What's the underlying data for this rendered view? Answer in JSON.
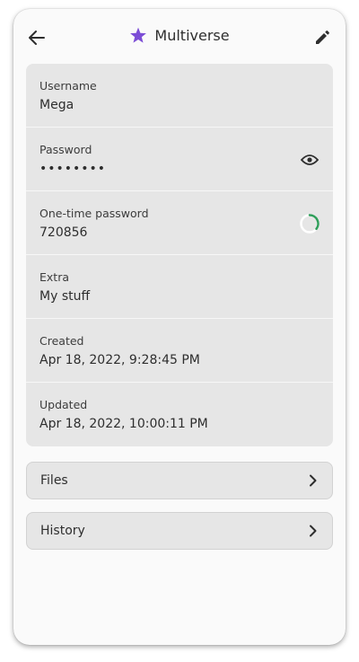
{
  "header": {
    "title": "Multiverse",
    "back_icon": "arrow-left-icon",
    "title_icon": "star-icon",
    "edit_icon": "pencil-icon",
    "star_color": "#7c4dd6"
  },
  "fields": [
    {
      "label": "Username",
      "value": "Mega"
    },
    {
      "label": "Password",
      "value": "••••••••",
      "action_icon": "eye-icon"
    },
    {
      "label": "One-time password",
      "value": "720856",
      "progress_icon": "countdown-spinner-icon",
      "progress_color": "#2f9e5a"
    },
    {
      "label": "Extra",
      "value": "My stuff"
    },
    {
      "label": "Created",
      "value": "Apr 18, 2022, 9:28:45 PM"
    },
    {
      "label": "Updated",
      "value": "Apr 18, 2022, 10:00:11 PM"
    }
  ],
  "nav": {
    "files_label": "Files",
    "history_label": "History",
    "chevron_icon": "chevron-right-icon"
  }
}
